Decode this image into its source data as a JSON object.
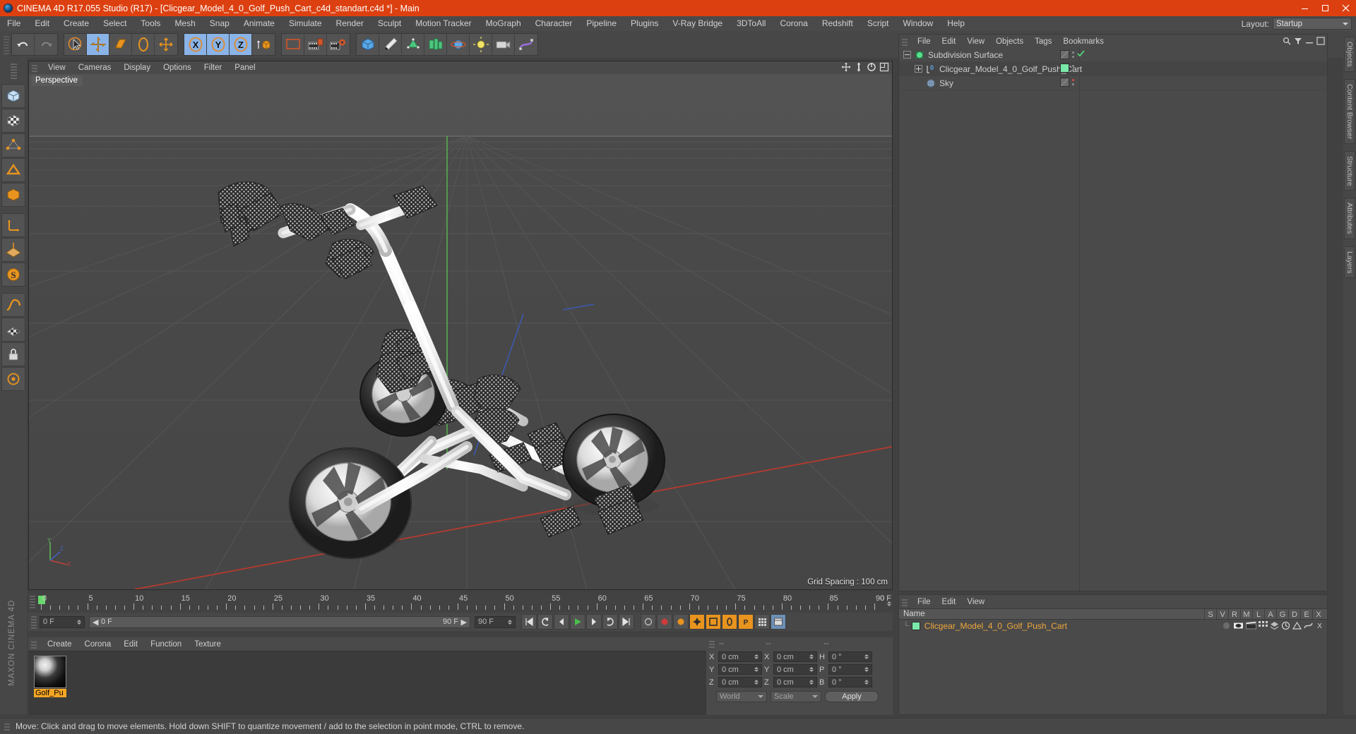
{
  "window": {
    "title": "CINEMA 4D R17.055 Studio (R17) - [Clicgear_Model_4_0_Golf_Push_Cart_c4d_standart.c4d *] - Main",
    "minimize": "minimize-icon",
    "maximize": "maximize-icon",
    "close": "close-icon"
  },
  "menubar": {
    "items": [
      "File",
      "Edit",
      "Create",
      "Select",
      "Tools",
      "Mesh",
      "Snap",
      "Animate",
      "Simulate",
      "Render",
      "Sculpt",
      "Motion Tracker",
      "MoGraph",
      "Character",
      "Pipeline",
      "Plugins",
      "V-Ray Bridge",
      "3DToAll",
      "Corona",
      "Redshift",
      "Script",
      "Window",
      "Help"
    ],
    "layout_label": "Layout:",
    "layout_value": "Startup"
  },
  "toolbar": {
    "groups": [
      {
        "name": "history",
        "buttons": [
          {
            "icon": "undo-icon",
            "label": "Undo",
            "active": false
          },
          {
            "icon": "redo-icon",
            "label": "Redo",
            "active": false
          }
        ]
      },
      {
        "name": "transform",
        "buttons": [
          {
            "icon": "select-cursor-icon",
            "label": "Live Selection",
            "active": false
          },
          {
            "icon": "move-icon",
            "label": "Move",
            "active": true
          },
          {
            "icon": "scale-icon",
            "label": "Scale",
            "active": false
          },
          {
            "icon": "rotate-icon",
            "label": "Rotate",
            "active": false
          },
          {
            "icon": "move-alt-icon",
            "label": "Move Tool",
            "active": false
          }
        ]
      },
      {
        "name": "axis-lock",
        "buttons": [
          {
            "icon": "x-axis-icon",
            "label": "X Axis",
            "active": true
          },
          {
            "icon": "y-axis-icon",
            "label": "Y Axis",
            "active": true
          },
          {
            "icon": "z-axis-icon",
            "label": "Z Axis",
            "active": true
          },
          {
            "icon": "world-object-axis-icon",
            "label": "World/Object",
            "active": false
          }
        ]
      },
      {
        "name": "render",
        "buttons": [
          {
            "icon": "render-view-icon",
            "label": "Render View",
            "active": false
          },
          {
            "icon": "render-picture-viewer-icon",
            "label": "Render to Picture Viewer",
            "active": false
          },
          {
            "icon": "render-settings-icon",
            "label": "Edit Render Settings",
            "active": false
          }
        ]
      },
      {
        "name": "objects",
        "buttons": [
          {
            "icon": "cube-primitive-icon",
            "label": "Add Cube Object",
            "active": false
          },
          {
            "icon": "spline-pen-icon",
            "label": "Create Spline",
            "active": false
          },
          {
            "icon": "generator-nurbs-icon",
            "label": "Subdivision Surface",
            "active": false
          },
          {
            "icon": "array-icon",
            "label": "Modeling Objects",
            "active": false
          },
          {
            "icon": "scene-object-icon",
            "label": "Scene Objects",
            "active": false
          },
          {
            "icon": "light-icon",
            "label": "Add Light",
            "active": false
          },
          {
            "icon": "camera-icon",
            "label": "Add Camera",
            "active": false
          },
          {
            "icon": "deformer-icon",
            "label": "Add Deformer",
            "active": false
          }
        ]
      }
    ]
  },
  "left_palette": {
    "buttons": [
      {
        "icon": "model-mode-icon",
        "label": "Model Mode"
      },
      {
        "icon": "texture-mode-icon",
        "label": "Texture Mode"
      },
      {
        "icon": "points-mode-icon",
        "label": "Points Mode"
      },
      {
        "icon": "edges-mode-icon",
        "label": "Edges Mode"
      },
      {
        "icon": "polygons-mode-icon",
        "label": "Polygons Mode"
      },
      {
        "icon": "axis-mode-icon",
        "label": "Enable Axis"
      },
      {
        "icon": "workplane-icon",
        "label": "Workplane"
      },
      {
        "icon": "viewport-lock-icon",
        "label": "Lock Workplane"
      },
      {
        "icon": "quantize-icon",
        "label": "Enable Quantizing"
      },
      {
        "icon": "snap-icon",
        "label": "Enable Snapping"
      },
      {
        "icon": "texture-axis-icon",
        "label": "Texture Axis"
      }
    ],
    "brand": "MAXON CINEMA 4D"
  },
  "viewport": {
    "menu": [
      "View",
      "Cameras",
      "Display",
      "Options",
      "Filter",
      "Panel"
    ],
    "label": "Perspective",
    "grid_spacing": "Grid Spacing : 100 cm",
    "corner_icons": [
      "pan-view-icon",
      "dolly-view-icon",
      "rotate-view-icon",
      "maximize-view-icon"
    ]
  },
  "timeline": {
    "ticks": [
      "0",
      "5",
      "10",
      "15",
      "20",
      "25",
      "30",
      "35",
      "40",
      "45",
      "50",
      "55",
      "60",
      "65",
      "70",
      "75",
      "80",
      "85",
      "90"
    ],
    "end_frame": "0 F",
    "current_frame_field": "0 F",
    "preview_start": "0 F",
    "preview_end_label": "90 F",
    "preview_end_field": "90 F",
    "buttons": [
      {
        "icon": "goto-start-icon",
        "label": "Go to Start"
      },
      {
        "icon": "step-back-keyframe-icon",
        "label": "Go to Previous Key"
      },
      {
        "icon": "step-back-icon",
        "label": "Go to Previous Frame"
      },
      {
        "icon": "play-icon",
        "label": "Play Forwards"
      },
      {
        "icon": "step-forward-icon",
        "label": "Go to Next Frame"
      },
      {
        "icon": "step-forward-keyframe-icon",
        "label": "Go to Next Key"
      },
      {
        "icon": "goto-end-icon",
        "label": "Go to End"
      },
      {
        "icon": "record-active-objects-icon",
        "label": "Record Active Objects"
      },
      {
        "icon": "autokeying-icon",
        "label": "Autokeying"
      },
      {
        "icon": "keyframe-selection-icon",
        "label": "Keyframe Selection"
      },
      {
        "icon": "position-key-icon",
        "label": "Position"
      },
      {
        "icon": "scale-key-icon",
        "label": "Scale"
      },
      {
        "icon": "rotation-key-icon",
        "label": "Rotation"
      },
      {
        "icon": "parameter-key-icon",
        "label": "Parameter"
      },
      {
        "icon": "pla-key-icon",
        "label": "Point Level Animation"
      },
      {
        "icon": "timeline-panel-icon",
        "label": "Timeline"
      }
    ]
  },
  "material_manager": {
    "menu": [
      "Create",
      "Corona",
      "Edit",
      "Function",
      "Texture"
    ],
    "materials": [
      {
        "name": "Golf_Pu",
        "icon": "material-sphere-icon",
        "selected": true
      }
    ]
  },
  "coordinate_manager": {
    "headers": [
      "--",
      "--",
      "--"
    ],
    "rows": [
      {
        "pos_label": "X",
        "pos_value": "0 cm",
        "size_label": "X",
        "size_value": "0 cm",
        "rot_label": "H",
        "rot_value": "0 °"
      },
      {
        "pos_label": "Y",
        "pos_value": "0 cm",
        "size_label": "Y",
        "size_value": "0 cm",
        "rot_label": "P",
        "rot_value": "0 °"
      },
      {
        "pos_label": "Z",
        "pos_value": "0 cm",
        "size_label": "Z",
        "size_value": "0 cm",
        "rot_label": "B",
        "rot_value": "0 °"
      }
    ],
    "coord_system": "World",
    "size_mode": "Scale",
    "apply_label": "Apply"
  },
  "object_manager": {
    "menu": [
      "File",
      "Edit",
      "View",
      "Objects",
      "Tags",
      "Bookmarks"
    ],
    "corner_icons": [
      "search-icon",
      "filter-icon",
      "minimize-panel-icon",
      "close-panel-icon"
    ],
    "objects": [
      {
        "name": "Subdivision Surface",
        "icon": "subdivision-surface-icon",
        "depth": 0,
        "expander": "minus",
        "visible_dot": "green-check",
        "tag": "none"
      },
      {
        "name": "Clicgear_Model_4_0_Golf_Push_Cart",
        "icon": "polygon-object-icon",
        "depth": 1,
        "expander": "plus",
        "visible_dot": "grey",
        "tag": "green-material"
      },
      {
        "name": "Sky",
        "icon": "sky-object-icon",
        "depth": 1,
        "expander": "none",
        "visible_dot": "red",
        "tag": "none"
      }
    ]
  },
  "attribute_manager": {
    "menu": [
      "File",
      "Edit",
      "View"
    ],
    "columns": [
      "Name",
      "S",
      "V",
      "R",
      "M",
      "L",
      "A",
      "G",
      "D",
      "E",
      "X"
    ],
    "rows": [
      {
        "name": "Clicgear_Model_4_0_Golf_Push_Cart",
        "swatch": "#7ae8a8"
      }
    ]
  },
  "right_tabs": [
    "Objects",
    "Content Browser",
    "Structure",
    "Attributes",
    "Layers"
  ],
  "statusbar": {
    "text": "Move: Click and drag to move elements. Hold down SHIFT to quantize movement / add to the selection in point mode, CTRL to remove."
  },
  "colors": {
    "title_bar": "#dd4010",
    "panel_bg": "#4a4a4a",
    "toolbar_bg": "#474747",
    "active_tool": "#8ab4e8",
    "viewport_bg": "#4c4c4c",
    "text": "#c8c8c8",
    "selection_orange": "#f0a83c",
    "material_label": "#f5a623",
    "axis_x": "#c1403a",
    "axis_y": "#5ab552",
    "axis_z": "#4060c0"
  }
}
